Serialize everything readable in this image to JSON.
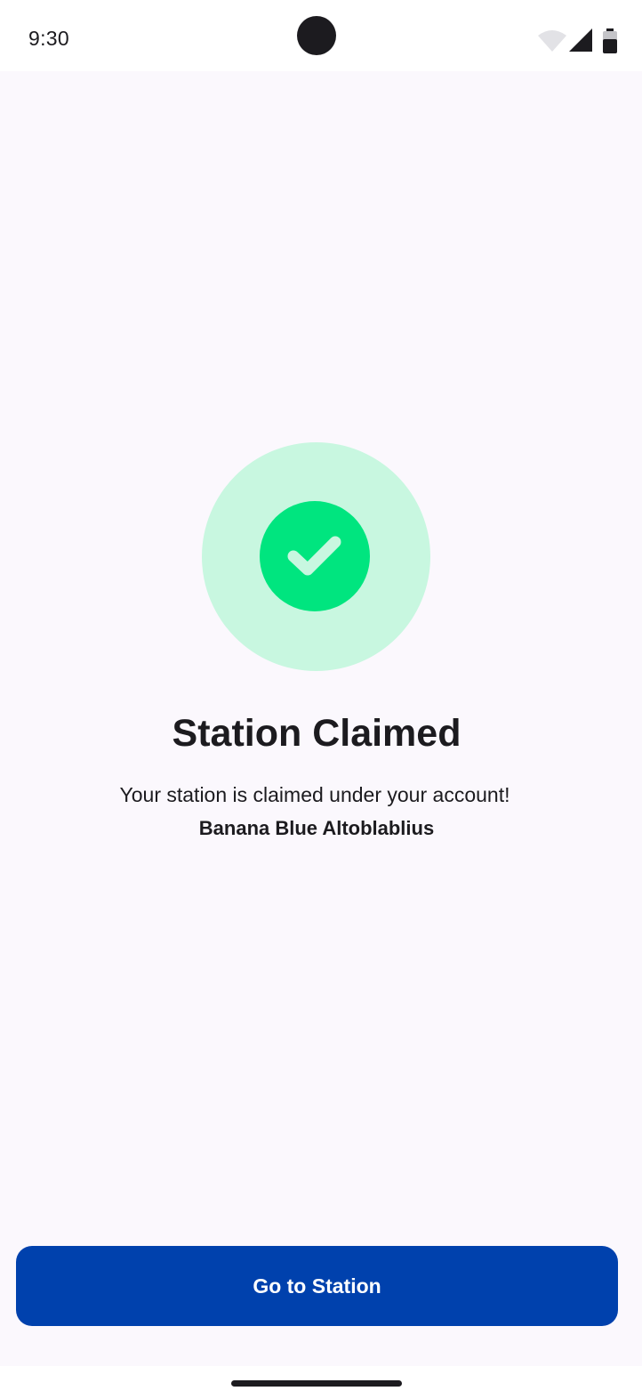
{
  "status_bar": {
    "time": "9:30",
    "icons": [
      "wifi-icon",
      "signal-icon",
      "battery-icon"
    ]
  },
  "success_icon": "check-circle-icon",
  "main": {
    "title": "Station Claimed",
    "message": "Your station is claimed under your account!",
    "station_name": "Banana Blue Altoblablius"
  },
  "actions": {
    "primary_label": "Go to Station"
  },
  "colors": {
    "background": "#fbf8fd",
    "success_light": "#c8f7e0",
    "success": "#00e57f",
    "primary": "#0041ad",
    "text": "#1c1b1f"
  }
}
